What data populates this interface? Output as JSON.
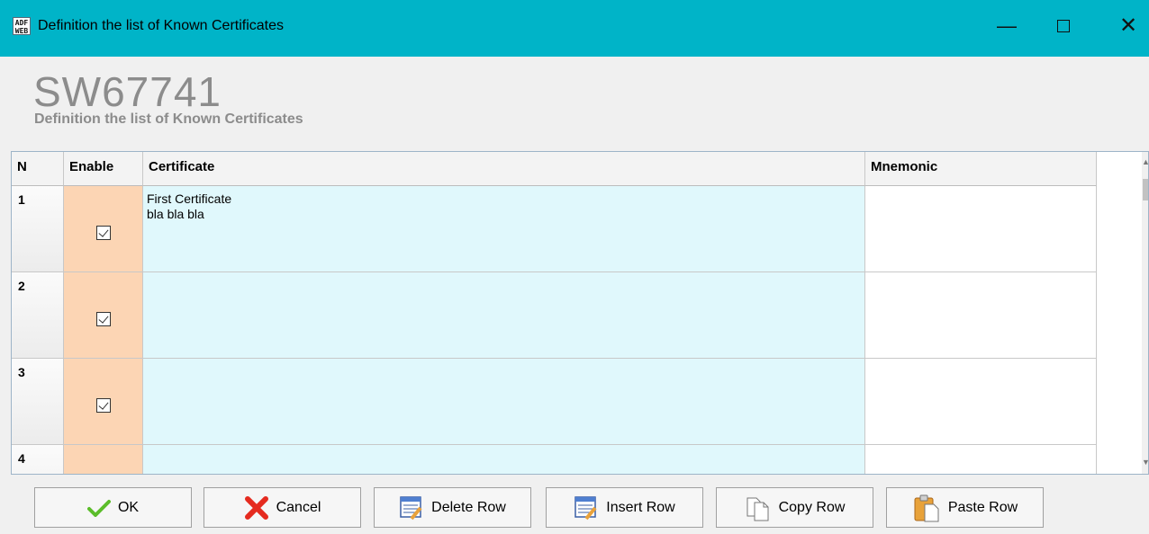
{
  "window": {
    "title": "Definition the list of Known Certificates",
    "icon_text": "ADF\nWEB",
    "minimize_glyph": "—",
    "close_glyph": "✕"
  },
  "header": {
    "title": "SW67741",
    "subtitle": "Definition the list of Known Certificates"
  },
  "table": {
    "columns": {
      "n": "N",
      "enable": "Enable",
      "certificate": "Certificate",
      "mnemonic": "Mnemonic"
    },
    "rows": [
      {
        "n": "1",
        "enabled": true,
        "certificate": "First Certificate\nbla bla bla",
        "mnemonic": ""
      },
      {
        "n": "2",
        "enabled": true,
        "certificate": "",
        "mnemonic": ""
      },
      {
        "n": "3",
        "enabled": true,
        "certificate": "",
        "mnemonic": ""
      },
      {
        "n": "4",
        "enabled": null,
        "certificate": "",
        "mnemonic": ""
      }
    ]
  },
  "buttons": {
    "ok": "OK",
    "cancel": "Cancel",
    "delete_row": "Delete Row",
    "insert_row": "Insert Row",
    "copy_row": "Copy Row",
    "paste_row": "Paste Row"
  },
  "colors": {
    "titlebar": "#00b4c8",
    "enable_cell": "#fcd5b4",
    "certificate_cell": "#e0f8fc"
  }
}
